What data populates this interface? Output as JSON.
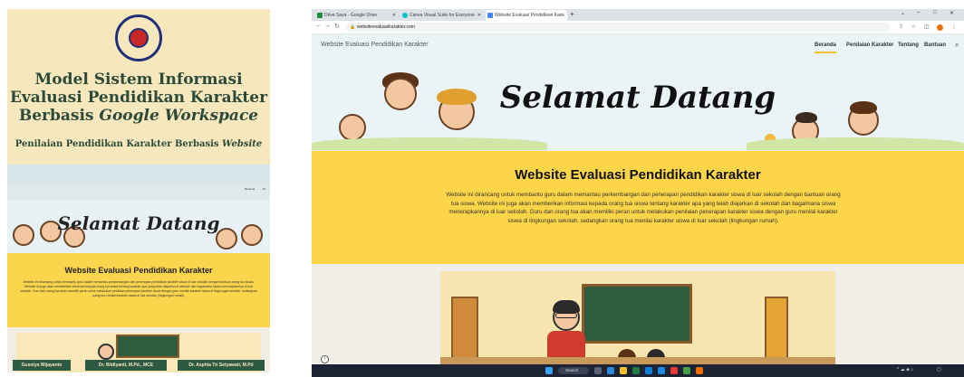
{
  "poster": {
    "title_line1": "Model Sistem Informasi",
    "title_line2": "Evaluasi Pendidikan Karakter",
    "title_line3_prefix": "Berbasis ",
    "title_line3_italic": "Google Workspace",
    "subtitle_prefix": "Penilaian Pendidikan Karakter Berbasis ",
    "subtitle_italic": "Website",
    "mini_welcome": "Selamat Datang",
    "mini_heading": "Website Evaluasi Pendidikan Karakter",
    "mini_nav": [
      "Beranda",
      "Pe"
    ],
    "authors": [
      "Gusniya Wijayanto",
      "Dr. Widiyanti, M.Pd., MCE",
      "Dr. Asphia Tri Setyawati, M.Pd"
    ]
  },
  "browser": {
    "tabs": [
      {
        "label": "Drive Saya - Google Drive",
        "icon_color": "#1e8e3e",
        "active": false
      },
      {
        "label": "Canva Visual Suite for Everyone",
        "icon_color": "#00c4cc",
        "active": false
      },
      {
        "label": "Website Evaluasi Pendidikan Kar...",
        "icon_color": "#4285f4",
        "active": true
      }
    ],
    "new_tab": "+",
    "url": "websiteevaluasikarakter.com",
    "controls": {
      "minimize": "–",
      "maximize": "□",
      "close": "✕",
      "dropdown": "⌄"
    }
  },
  "site": {
    "name": "Website Evaluasi Pendidikan Karakter",
    "nav": [
      "Beranda",
      "Penilaian Karakter",
      "Tentang",
      "Bantuan"
    ],
    "active_nav": "Beranda",
    "hero_title": "Selamat Datang",
    "heading": "Website Evaluasi Pendidikan Karakter",
    "description": "Website ini dirancang untuk membantu guru dalam memantau perkembangan dan penerapan pendidikan karakter siswa di luar sekolah dengan bantuan orang tua siswa. Website ini juga akan memberikan informasi kepada orang tua siswa tentang karakter apa yang telah diajarkan di sekolah dan bagaimana siswa menerapkannya di luar sekolah. Guru dan orang tua akan memiliki peran untuk melakukan penilaian penerapan karakter siswa dengan guru menilai karakter siswa di lingkungan sekolah, sedangkan orang tua menilai karakter siswa di luar sekolah (lingkungan rumah).",
    "info_icon": "i"
  },
  "taskbar": {
    "search_label": "Search"
  },
  "colors": {
    "accent_yellow": "#fcd548",
    "poster_bg": "#f5e6b8",
    "poster_title": "#2c4a3a",
    "taskbar": "#1c2333"
  }
}
